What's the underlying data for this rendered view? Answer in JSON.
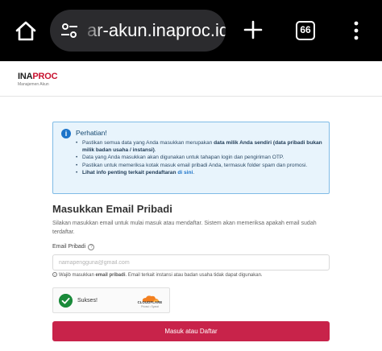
{
  "browser": {
    "url": "ar-akun.inaproc.id",
    "tab_count": "66",
    "icons": [
      "home-icon",
      "tune-icon",
      "plus-icon",
      "tab-switcher-icon",
      "more-vert-icon"
    ]
  },
  "site": {
    "logo_main": "INA",
    "logo_accent": "PROC",
    "logo_sub": "Manajemen Akun"
  },
  "alert": {
    "title": "Perhatian!",
    "items": [
      {
        "before": "Pastikan semua data yang Anda masukkan merupakan ",
        "bold": "data milik Anda sendiri (data pribadi bukan milik badan usaha / instansi)",
        "after": "."
      },
      {
        "text": "Data yang Anda masukkan akan digunakan untuk tahapan login dan pengiriman OTP."
      },
      {
        "text": "Pastikan untuk memeriksa kotak masuk email pribadi Anda, termasuk folder spam dan promosi."
      },
      {
        "bold": "Lihat info penting terkait pendaftaran ",
        "link": "di sini",
        "after": "."
      }
    ],
    "colors": {
      "background": "#e8f4fc",
      "border": "#7fbbe6",
      "icon": "#1d74c9"
    }
  },
  "form": {
    "title": "Masukkan Email Pribadi",
    "description": "Silakan masukkan email untuk mulai masuk atau mendaftar. Sistem akan memeriksa apakah email sudah terdaftar.",
    "email_label": "Email Pribadi",
    "email_placeholder": "namapengguna@gmail.com",
    "email_value": "",
    "note_prefix": "Wajib masukkan ",
    "note_bold": "email pribadi",
    "note_suffix": ". Email terkait instansi atau badan usaha tidak dapat digunakan."
  },
  "captcha": {
    "status": "Sukses!",
    "brand": "CLOUDFLARE",
    "links": "Privasi • Syarat"
  },
  "submit": {
    "label": "Masuk atau Daftar",
    "color": "#c8234a"
  }
}
